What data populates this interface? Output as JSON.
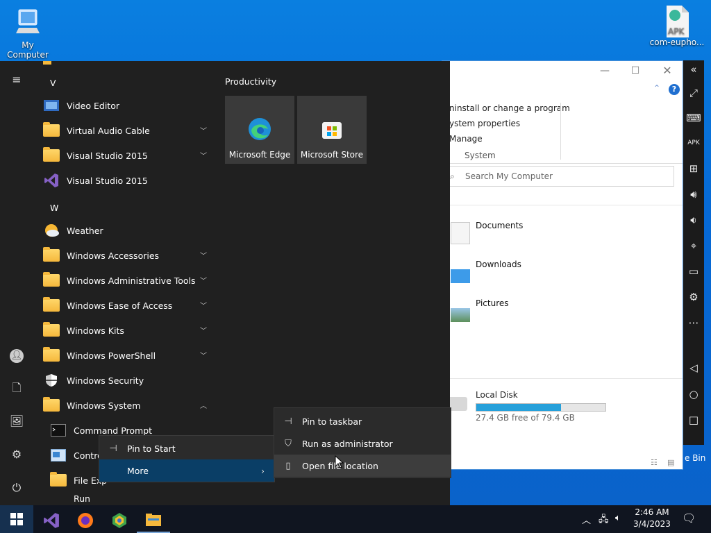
{
  "desktop": {
    "my_computer_label": "My Computer",
    "apk_label": "com-eupho...",
    "apk_icon_text": "APK"
  },
  "explorer": {
    "ribbon_items": [
      "ninstall or change a program",
      "ystem properties",
      "Manage"
    ],
    "ribbon_group": "System",
    "search_placeholder": "Search My Computer",
    "folders": [
      "Documents",
      "Downloads",
      "Pictures"
    ],
    "disk_name": "Local Disk",
    "disk_free": "27.4 GB free of 79.4 GB",
    "disk_used_fraction": 0.655,
    "recycle_partial": "e Bin",
    "help_glyph": "?"
  },
  "start_menu": {
    "letters": {
      "v": "V",
      "w": "W"
    },
    "apps": [
      {
        "label": "Video Editor",
        "icon": "video-editor-icon",
        "expandable": false
      },
      {
        "label": "Virtual Audio Cable",
        "icon": "folder-icon",
        "expandable": true
      },
      {
        "label": "Visual Studio 2015",
        "icon": "folder-icon",
        "expandable": true
      },
      {
        "label": "Visual Studio 2015",
        "icon": "visual-studio-icon",
        "expandable": false
      },
      {
        "label": "Weather",
        "icon": "weather-icon",
        "expandable": false
      },
      {
        "label": "Windows Accessories",
        "icon": "folder-icon",
        "expandable": true
      },
      {
        "label": "Windows Administrative Tools",
        "icon": "folder-icon",
        "expandable": true
      },
      {
        "label": "Windows Ease of Access",
        "icon": "folder-icon",
        "expandable": true
      },
      {
        "label": "Windows Kits",
        "icon": "folder-icon",
        "expandable": true
      },
      {
        "label": "Windows PowerShell",
        "icon": "folder-icon",
        "expandable": true
      },
      {
        "label": "Windows Security",
        "icon": "shield-icon",
        "expandable": false
      },
      {
        "label": "Windows System",
        "icon": "folder-icon",
        "expandable": true
      }
    ],
    "sub_apps": [
      "Command Prompt",
      "Contro",
      "File Exp",
      "Run"
    ],
    "group_title": "Productivity",
    "tiles": [
      "Microsoft Edge",
      "Microsoft Store"
    ]
  },
  "context_menu": {
    "pin_to_start": "Pin to Start",
    "more": "More"
  },
  "more_menu": {
    "items": [
      "Pin to taskbar",
      "Run as administrator",
      "Open file location"
    ]
  },
  "taskbar": {
    "time": "2:46 AM",
    "date": "3/4/2023"
  },
  "colors": {
    "accent": "#0a6fd6",
    "disk_fill": "#26a0da",
    "start_bg": "#202020"
  }
}
